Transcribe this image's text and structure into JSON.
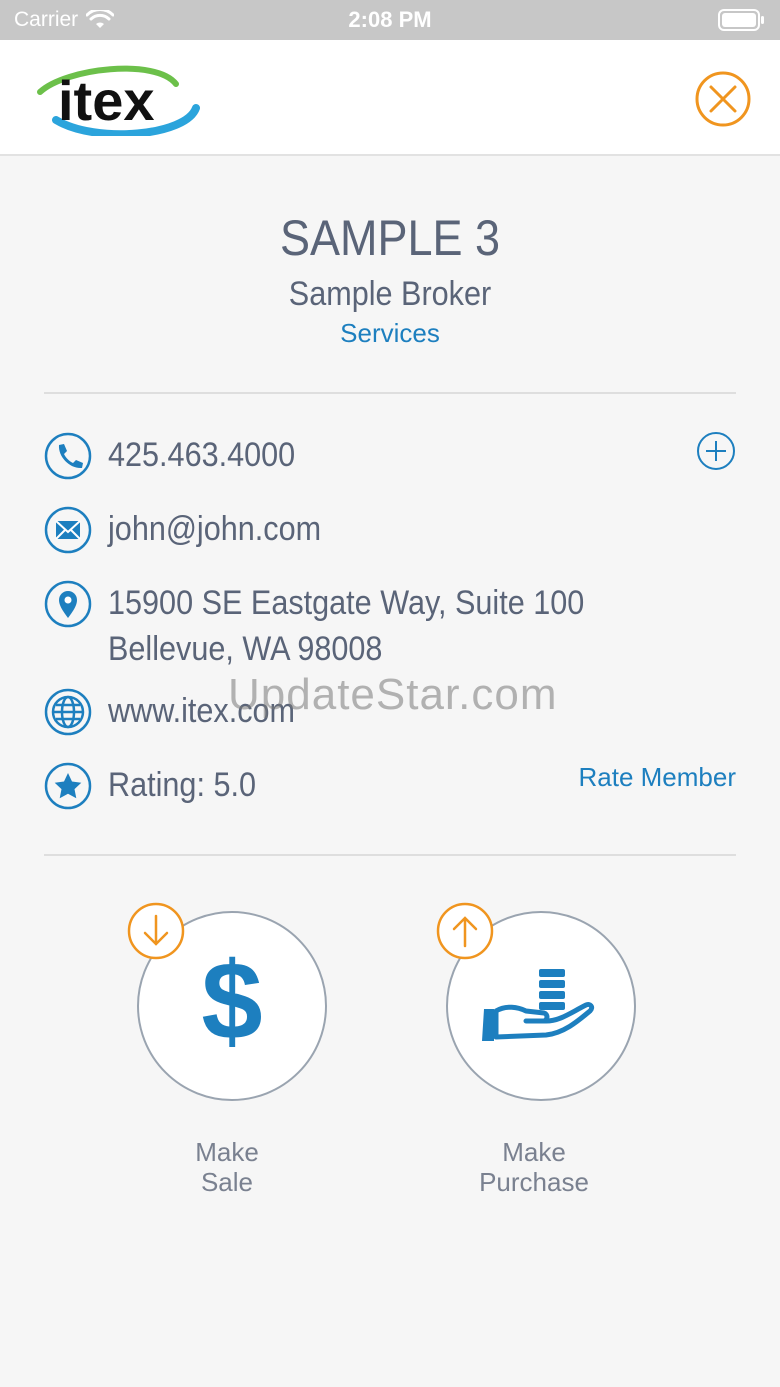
{
  "status_bar": {
    "carrier": "Carrier",
    "time": "2:08 PM"
  },
  "nav": {
    "logo_text": "itex",
    "close_icon": "close-circle-icon"
  },
  "member": {
    "name": "SAMPLE 3",
    "broker": "Sample Broker",
    "category": "Services"
  },
  "contact": {
    "phone": "425.463.4000",
    "email": "john@john.com",
    "address_line1": "15900 SE Eastgate Way, Suite 100",
    "address_line2": "Bellevue, WA 98008",
    "website": "www.itex.com",
    "rating": "Rating: 5.0",
    "rate_link": "Rate Member"
  },
  "actions": {
    "sale": {
      "line1": "Make",
      "line2": "Sale"
    },
    "purchase": {
      "line1": "Make",
      "line2": "Purchase"
    }
  },
  "watermark": "UpdateStar.com",
  "colors": {
    "accent_blue": "#1d7fbf",
    "accent_orange": "#f0951f",
    "text_gray": "#5a6478"
  }
}
